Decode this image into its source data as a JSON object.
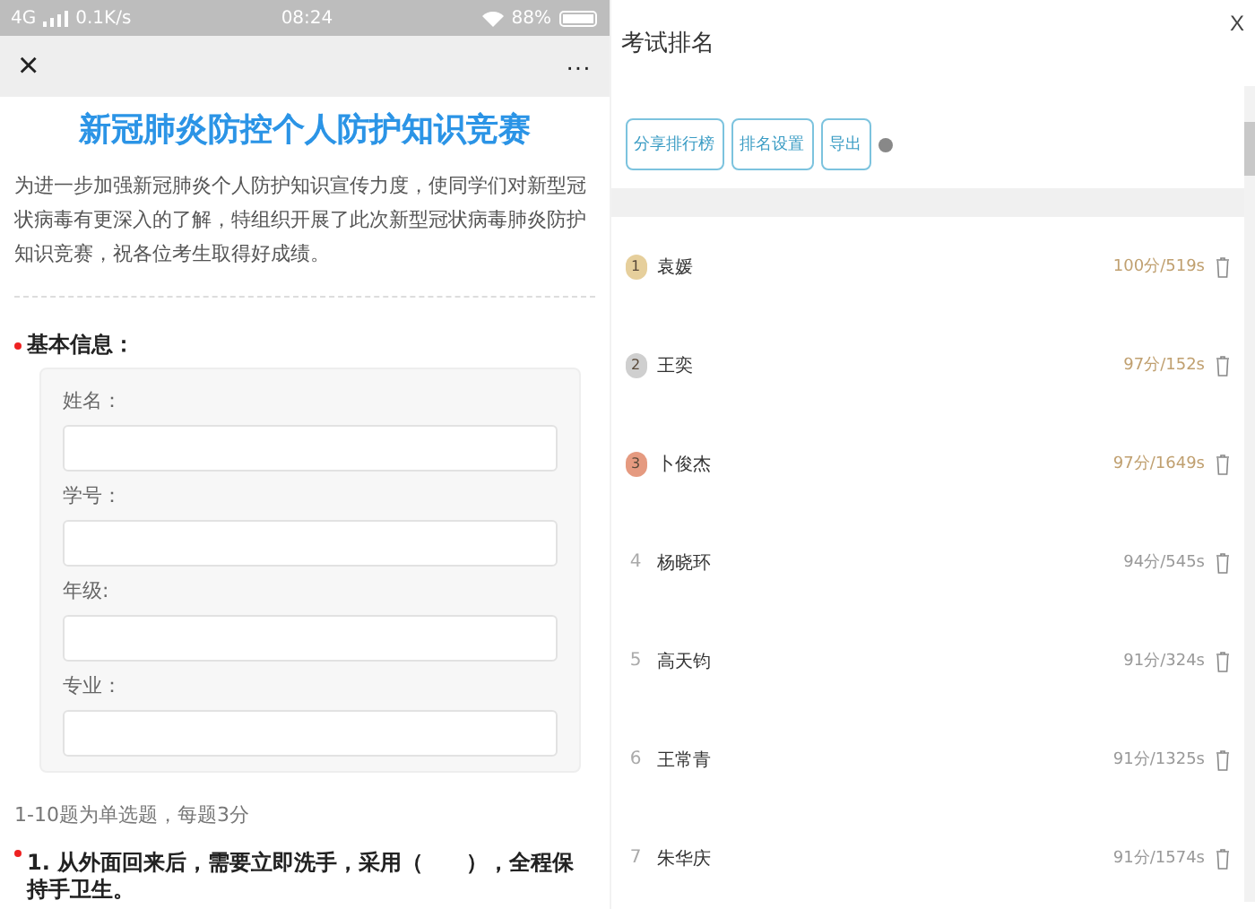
{
  "status_bar": {
    "network": "4G",
    "speed": "0.1K/s",
    "time": "08:24",
    "battery": "88%"
  },
  "nav": {
    "close": "×",
    "more": "···"
  },
  "quiz": {
    "title": "新冠肺炎防控个人防护知识竞赛",
    "intro": "为进一步加强新冠肺炎个人防护知识宣传力度，使同学们对新型冠状病毒有更深入的了解，特组织开展了此次新型冠状病毒肺炎防护知识竞赛，祝各位考生取得好成绩。",
    "section": {
      "label": "基本信息：",
      "required": true,
      "fields": [
        {
          "label": "姓名："
        },
        {
          "label": "学号："
        },
        {
          "label": "年级:"
        },
        {
          "label": "专业："
        }
      ]
    },
    "note": "1-10题为单选题，每题3分",
    "question": {
      "text": "1. 从外面回来后，需要立即洗手，采用（　　），全程保持手卫生。",
      "required": true
    }
  },
  "ranking": {
    "title": "考试排名",
    "close": "X",
    "buttons": [
      "分享排行榜",
      "排名设置",
      "导出"
    ],
    "rows": [
      {
        "rank": "1",
        "kind": "medal",
        "color": "#e6cf9c",
        "name": "袁媛",
        "score": "100分/519s"
      },
      {
        "rank": "2",
        "kind": "medal",
        "color": "#cfcfcf",
        "name": "王奕",
        "score": "97分/152s"
      },
      {
        "rank": "3",
        "kind": "medal",
        "color": "#e59a80",
        "name": "卜俊杰",
        "score": "97分/1649s"
      },
      {
        "rank": "4",
        "kind": "plain",
        "name": "杨晓环",
        "score": "94分/545s"
      },
      {
        "rank": "5",
        "kind": "plain",
        "name": "高天钧",
        "score": "91分/324s"
      },
      {
        "rank": "6",
        "kind": "plain",
        "name": "王常青",
        "score": "91分/1325s"
      },
      {
        "rank": "7",
        "kind": "plain",
        "name": "朱华庆",
        "score": "91分/1574s"
      }
    ]
  }
}
